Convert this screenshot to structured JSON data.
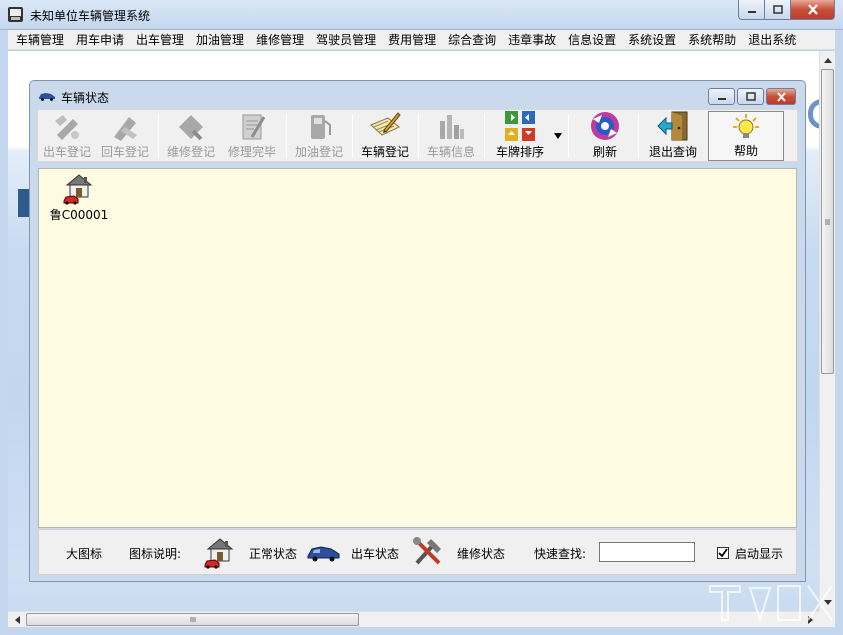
{
  "window": {
    "title": "未知单位车辆管理系统"
  },
  "menu": [
    "车辆管理",
    "用车申请",
    "出车管理",
    "加油管理",
    "维修管理",
    "驾驶员管理",
    "费用管理",
    "综合查询",
    "违章事故",
    "信息设置",
    "系统设置",
    "系统帮助",
    "退出系统"
  ],
  "inner_window": {
    "title": "车辆状态"
  },
  "toolbar": [
    {
      "label": "出车登记",
      "icon": "depart-icon",
      "enabled": false
    },
    {
      "label": "回车登记",
      "icon": "return-icon",
      "enabled": false
    },
    {
      "label": "维修登记",
      "icon": "repair-icon",
      "enabled": false
    },
    {
      "label": "修理完毕",
      "icon": "repair-done-icon",
      "enabled": false
    },
    {
      "label": "加油登记",
      "icon": "fuel-icon",
      "enabled": false
    },
    {
      "label": "车辆登记",
      "icon": "register-icon",
      "enabled": true
    },
    {
      "label": "车辆信息",
      "icon": "info-icon",
      "enabled": false
    },
    {
      "label": "车牌排序",
      "icon": "sort-icon",
      "enabled": true
    },
    {
      "label": "刷新",
      "icon": "refresh-icon",
      "enabled": true
    },
    {
      "label": "退出查询",
      "icon": "exit-icon",
      "enabled": true
    },
    {
      "label": "帮助",
      "icon": "help-icon",
      "enabled": true
    }
  ],
  "vehicles": [
    {
      "plate": "鲁C00001",
      "status": "正常状态"
    }
  ],
  "statusbar": {
    "view_mode": "大图标",
    "legend_label": "图标说明:",
    "legend": [
      "正常状态",
      "出车状态",
      "维修状态"
    ],
    "quick_search_label": "快速查找:",
    "quick_search_value": "",
    "auto_show_label": "启动显示",
    "auto_show_checked": true
  },
  "colors": {
    "content_bg": "#fdfbe1",
    "title_bg": "#c4d7ee",
    "close_red": "#c75039"
  }
}
